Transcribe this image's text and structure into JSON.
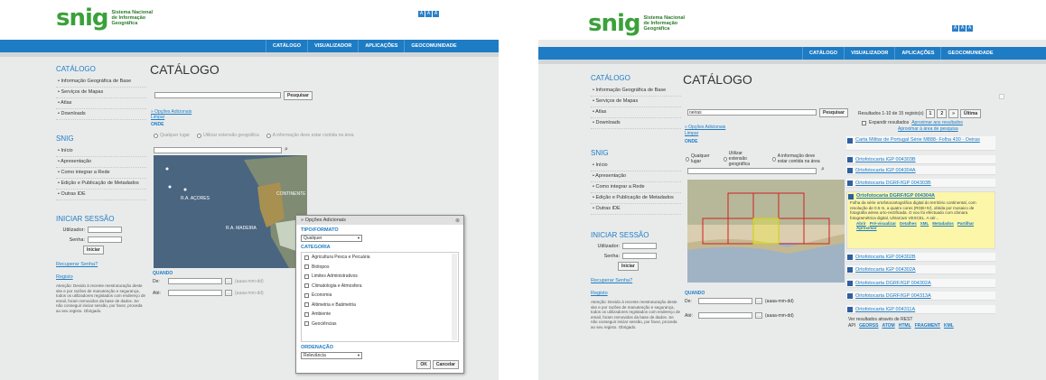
{
  "left": {
    "logo": {
      "mark": "snig",
      "line1": "Sistema Nacional",
      "line2": "de Informação",
      "line3": "Geográfica"
    },
    "a_buttons": [
      "A",
      "A",
      "A"
    ],
    "nav": [
      "CATÁLOGO",
      "VISUALIZADOR",
      "APLICAÇÕES",
      "GEOCOMUNIDADE"
    ],
    "sidebar": {
      "catalogo_head": "CATÁLOGO",
      "catalogo_items": [
        "Informação Geográfica de Base",
        "Serviços de Mapas",
        "Atlas",
        "Downloads"
      ],
      "snig_head": "SNIG",
      "snig_items": [
        "Início",
        "Apresentação",
        "Como integrar a Rede",
        "Edição e Publicação de Metadados",
        "Outras IDE"
      ],
      "login_head": "INICIAR SESSÃO",
      "user_label": "Utilizador:",
      "pass_label": "Senha:",
      "login_button": "Iniciar",
      "recover_link": "Recuperar Senha?",
      "register_link": "Registo",
      "notice": "Atenção: Devido à recente reestruturação deste site e por razões de manutenção e segurança, todos os utilizadores registados com endereço de email, foram removidos da base de dados. Se não conseguir iniciar sessão, por favor, proceda ao seu registo. Obrigado."
    },
    "main": {
      "title": "CATÁLOGO",
      "search_button": "Pesquisar",
      "adv_options": "» Opções Adicionais",
      "clear": "Limpar",
      "onde_label": "ONDE",
      "radio_any": "Qualquer lugar",
      "radio_ext": "Utilizar extensão geográfica",
      "radio_contained": "A informação deve estar contida na área",
      "map_labels": [
        "R.A. AÇORES",
        "CONTINENTE",
        "R.A. MADEIRA"
      ],
      "quando_label": "QUANDO",
      "de_label": "De:",
      "ate_label": "Até:",
      "date_hint": "(aaaa-mm-dd)"
    },
    "popup": {
      "title": "» Opções Adicionais",
      "tipo_label": "TIPO/FORMATO",
      "tipo_value": "Qualquer",
      "categoria_label": "CATEGORIA",
      "categories": [
        "Agricultura Pesca e Pecuária",
        "Biótopos",
        "Limites Administrativos",
        "Climatologia e Atmosfera",
        "Economia",
        "Altimetria e Batimetria",
        "Ambiente",
        "Geociências"
      ],
      "ordenacao_label": "ORDENAÇÃO",
      "ordenacao_value": "Relevância",
      "ok_button": "OK",
      "cancel_button": "Cancelar"
    }
  },
  "right": {
    "logo": {
      "mark": "snig",
      "line1": "Sistema Nacional",
      "line2": "de Informação",
      "line3": "Geográfica"
    },
    "a_buttons": [
      "A",
      "A",
      "A"
    ],
    "nav": [
      "CATÁLOGO",
      "VISUALIZADOR",
      "APLICAÇÕES",
      "GEOCOMUNIDADE"
    ],
    "sidebar": {
      "catalogo_head": "CATÁLOGO",
      "catalogo_items": [
        "Informação Geográfica de Base",
        "Serviços de Mapas",
        "Atlas",
        "Downloads"
      ],
      "snig_head": "SNIG",
      "snig_items": [
        "Início",
        "Apresentação",
        "Como integrar a Rede",
        "Edição e Publicação de Metadados",
        "Outras IDE"
      ],
      "login_head": "INICIAR SESSÃO",
      "user_label": "Utilizador:",
      "pass_label": "Senha:",
      "login_button": "Iniciar",
      "recover_link": "Recuperar Senha?",
      "register_link": "Registo",
      "notice": "Atenção: Devido à recente reestruturação deste site e por razões de manutenção e segurança, todos os utilizadores registados com endereço de email, foram removidos da base de dados. Se não conseguir iniciar sessão, por favor, proceda ao seu registo. Obrigado."
    },
    "main": {
      "title": "CATÁLOGO",
      "search_value": "oeiras",
      "search_button": "Pesquisar",
      "results_text": "Resultados 1-10 de 15 registo(s)",
      "pages": [
        "1",
        "2",
        "»",
        "Última"
      ],
      "expand_text": "Expandir resultados",
      "zoom_link": "Aproximar aos resultados",
      "zoom_area": "Aproximar à área de pesquisa",
      "adv_options": "» Opções Adicionais",
      "clear": "Limpar",
      "onde_label": "ONDE",
      "radio_any": "Qualquer lugar",
      "radio_ext": "Utilizar extensão geográfica",
      "radio_contained": "A informação deve estar contida na área",
      "quando_label": "QUANDO",
      "de_label": "De:",
      "ate_label": "Até:",
      "date_hint": "(aaaa-mm-dd)",
      "results": [
        "Carta Militar de Portugal Série M888- Folha 430 - Oeiras",
        "Ortofotocarta IGP 004303B",
        "Ortofotocarta IGP 004304A",
        "Ortofotocarta DGRF/IGP 004303B",
        "Ortofotocarta DGRF/IGP 004304A",
        "Ortofotocarta IGP 004302B",
        "Ortofotocarta IGP 004302A",
        "Ortofotocarta DGRF/IGP 004302A",
        "Ortofotocarta DGRF/IGP 004313A",
        "Ortofotocarta IGP 004311A"
      ],
      "highlight_desc": "Folha da série ortofotocartográfica digital do território continental, com resolução de 0.5 m, a quatro cores (RGB+IV), obtida por mosaico de fotografia aérea orto-rectificada. O voo foi efectuado com câmara fotogramétrica digital, UltraCam VEXCEL. A sér...",
      "highlight_links": [
        "Abrir",
        "Pré-visualizar",
        "Detalhes",
        "XML",
        "Metadados",
        "Partilhar",
        "Aproximar"
      ],
      "rest_text": "Ver resultados através de REST",
      "rest_links": [
        "API",
        "GEORSS",
        "ATOM",
        "HTML",
        "FRAGMENT",
        "KML"
      ]
    }
  }
}
